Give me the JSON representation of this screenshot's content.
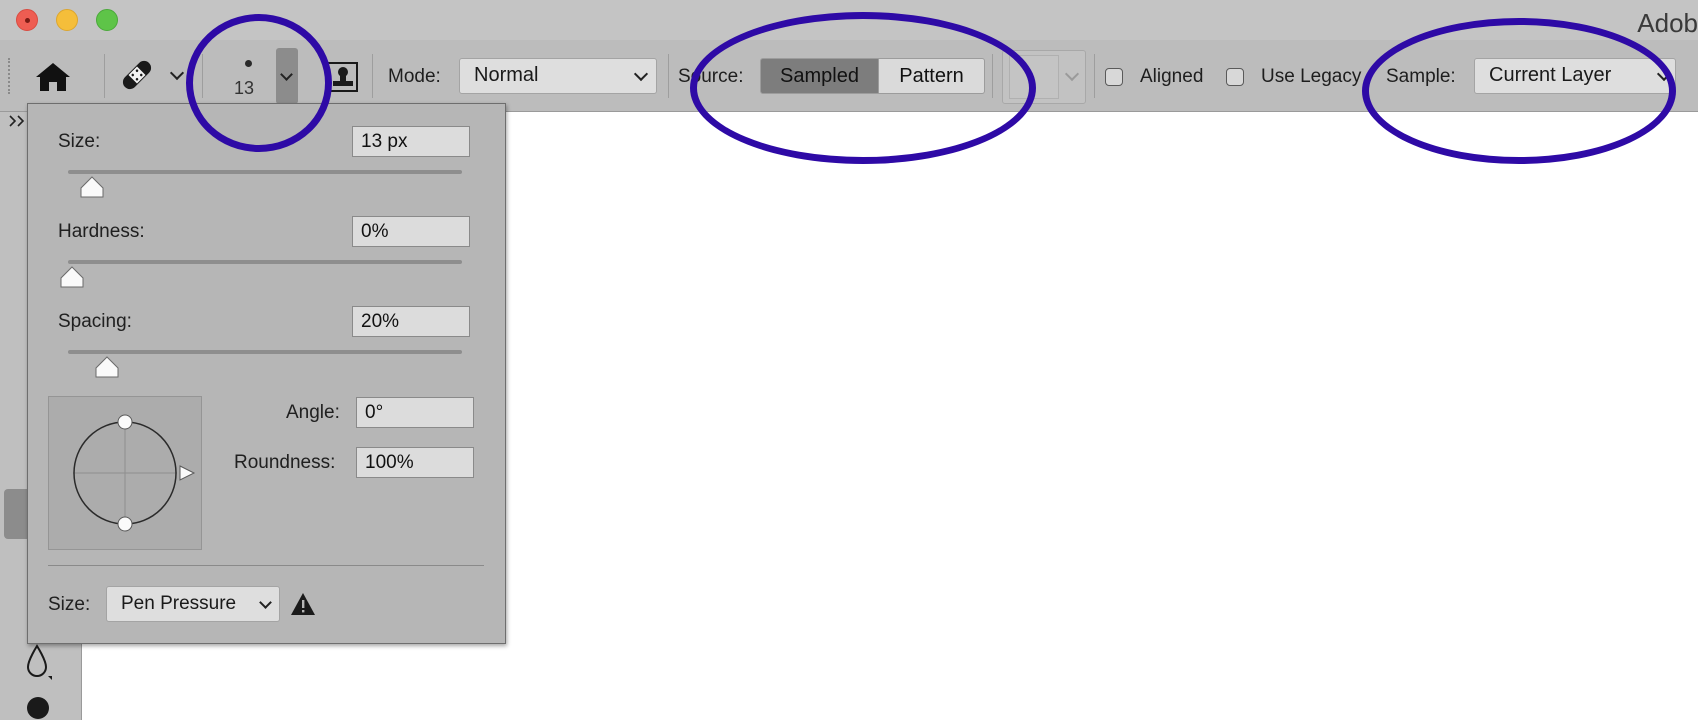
{
  "window": {
    "title": "Adob",
    "controls": [
      "close",
      "minimize",
      "maximize"
    ]
  },
  "options_bar": {
    "home_icon": "home-icon",
    "tool_icon": "bandage-icon",
    "brush_size": "13",
    "clone_source_icon": "clone-source-icon",
    "mode_label": "Mode:",
    "mode_value": "Normal",
    "source_label": "Source:",
    "source_options": [
      "Sampled",
      "Pattern"
    ],
    "source_selected": "Sampled",
    "aligned_label": "Aligned",
    "aligned_checked": false,
    "use_legacy_label": "Use Legacy",
    "use_legacy_checked": false,
    "sample_label": "Sample:",
    "sample_value": "Current Layer"
  },
  "brush_popup": {
    "size_label": "Size:",
    "size_value": "13 px",
    "size_slider": 0.05,
    "hardness_label": "Hardness:",
    "hardness_value": "0%",
    "hardness_slider": 0,
    "spacing_label": "Spacing:",
    "spacing_value": "20%",
    "spacing_slider": 0.09,
    "angle_label": "Angle:",
    "angle_value": "0°",
    "roundness_label": "Roundness:",
    "roundness_value": "100%",
    "pressure_size_label": "Size:",
    "pressure_size_value": "Pen Pressure",
    "warning_icon": "warning-icon"
  },
  "annotations": {
    "color": "#2e0aa6",
    "circled": [
      "brush-size-preset",
      "source-toggle",
      "sample-dropdown"
    ]
  }
}
